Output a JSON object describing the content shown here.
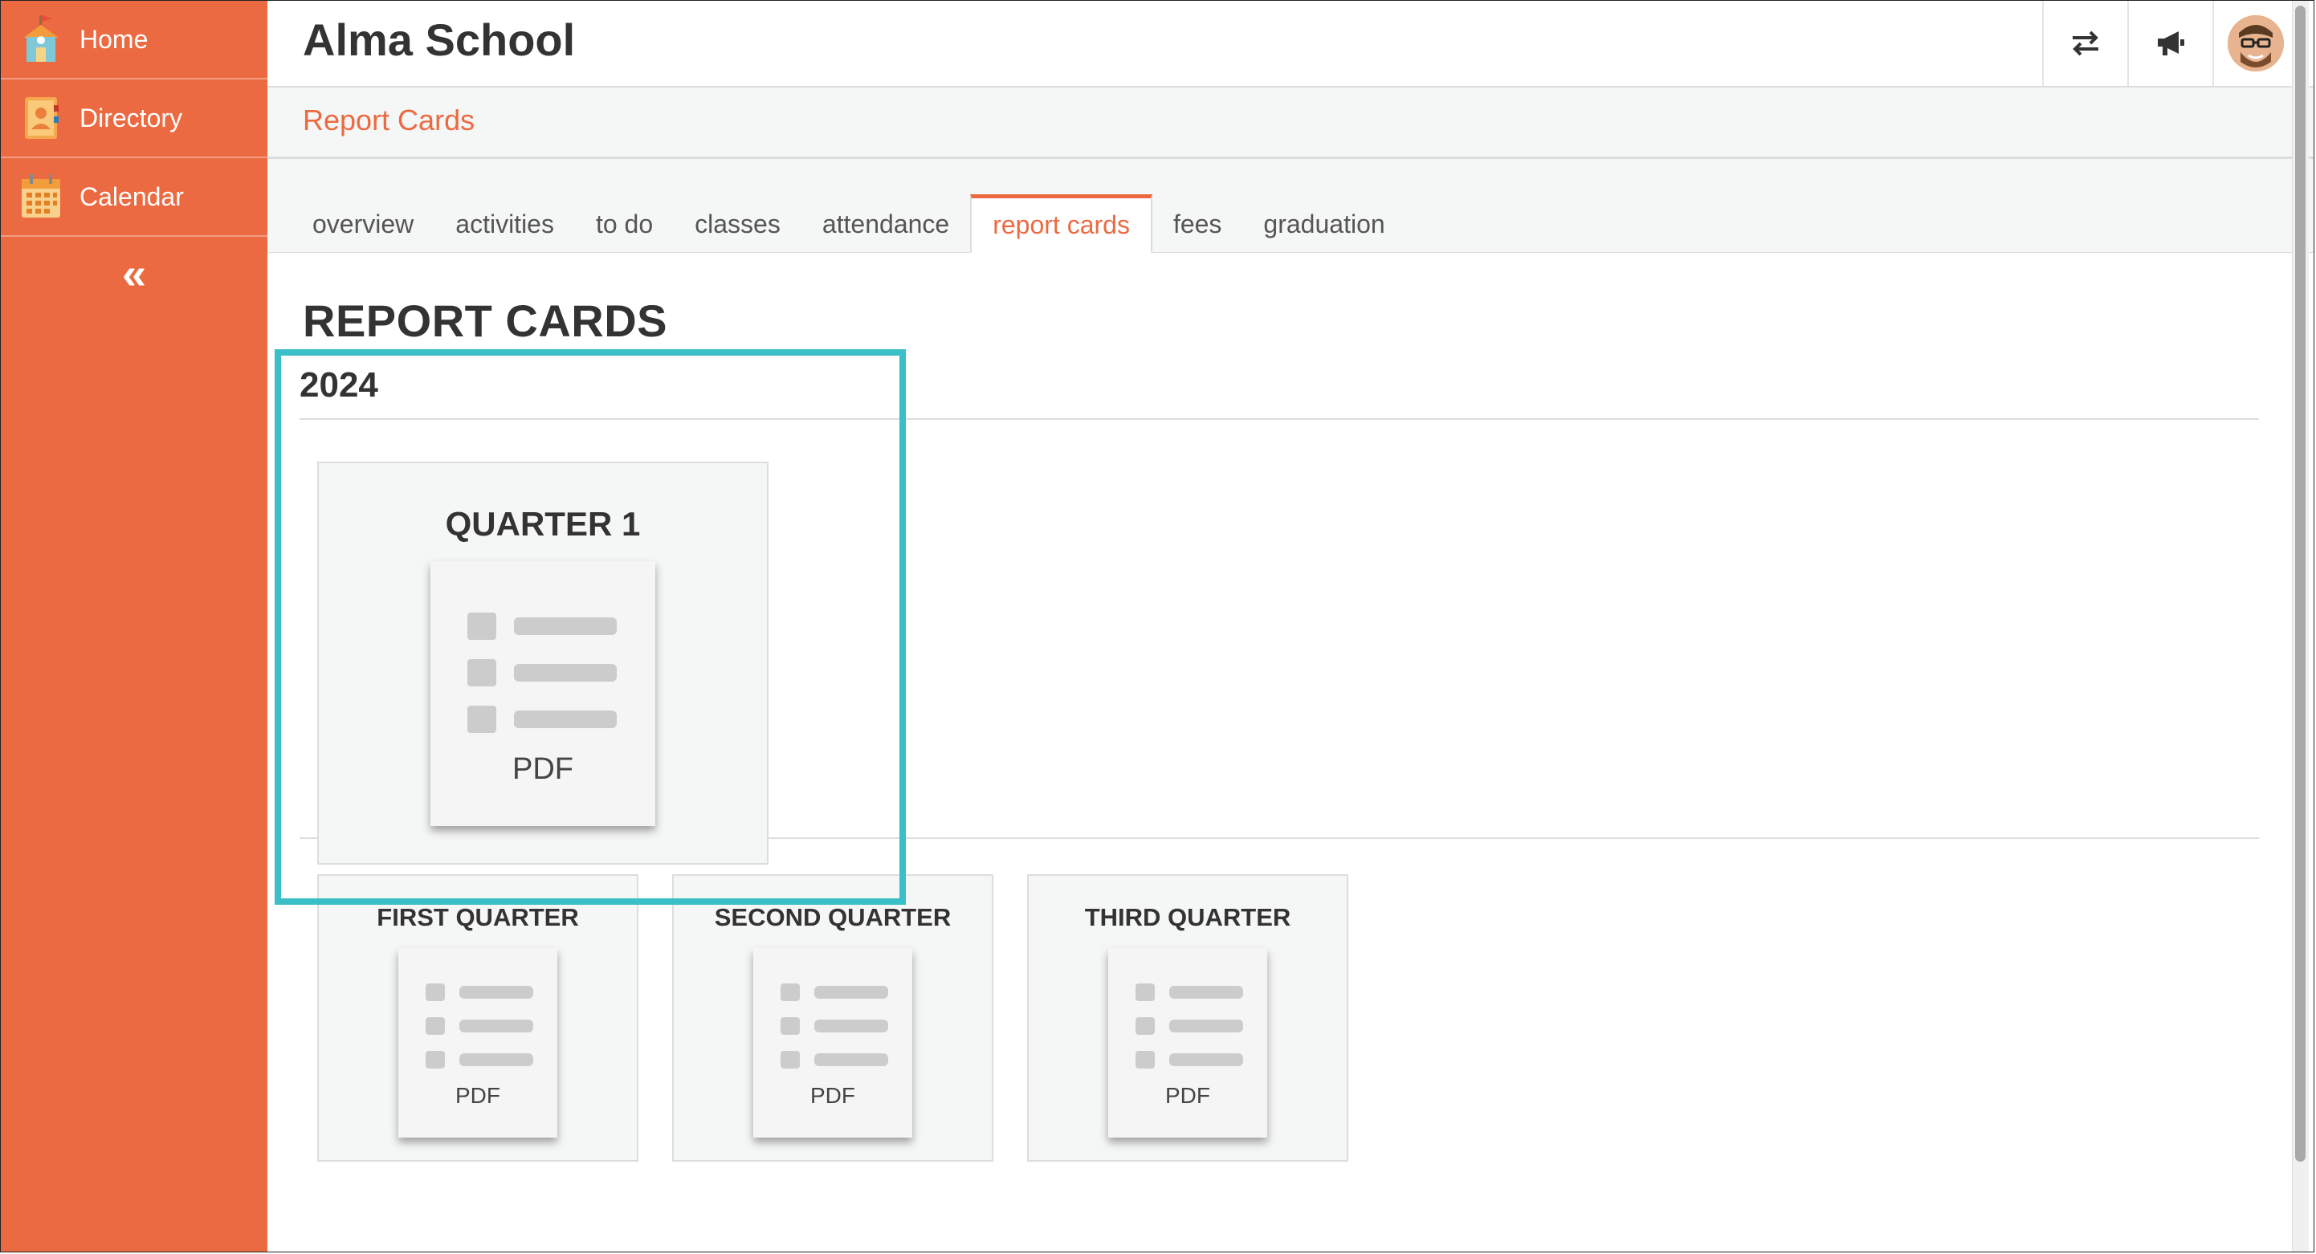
{
  "sidebar": {
    "items": [
      {
        "label": "Home",
        "icon": "school-icon"
      },
      {
        "label": "Directory",
        "icon": "contact-book-icon"
      },
      {
        "label": "Calendar",
        "icon": "calendar-icon"
      }
    ],
    "collapse_label": "«"
  },
  "header": {
    "title": "Alma School",
    "actions": [
      "switch-icon",
      "megaphone-icon",
      "avatar"
    ]
  },
  "breadcrumb": {
    "label": "Report Cards"
  },
  "tabs": [
    {
      "label": "overview"
    },
    {
      "label": "activities"
    },
    {
      "label": "to do"
    },
    {
      "label": "classes"
    },
    {
      "label": "attendance"
    },
    {
      "label": "report cards",
      "active": true
    },
    {
      "label": "fees"
    },
    {
      "label": "graduation"
    }
  ],
  "main": {
    "page_title": "REPORT CARDS",
    "year": "2024",
    "featured_card": {
      "title": "QUARTER 1",
      "file_label": "PDF"
    },
    "cards": [
      {
        "title": "FIRST QUARTER",
        "file_label": "PDF"
      },
      {
        "title": "SECOND QUARTER",
        "file_label": "PDF"
      },
      {
        "title": "THIRD QUARTER",
        "file_label": "PDF"
      }
    ]
  },
  "colors": {
    "accent": "#ec6a41",
    "highlight": "#3bbfc7",
    "panel_bg": "#f5f6f6"
  }
}
